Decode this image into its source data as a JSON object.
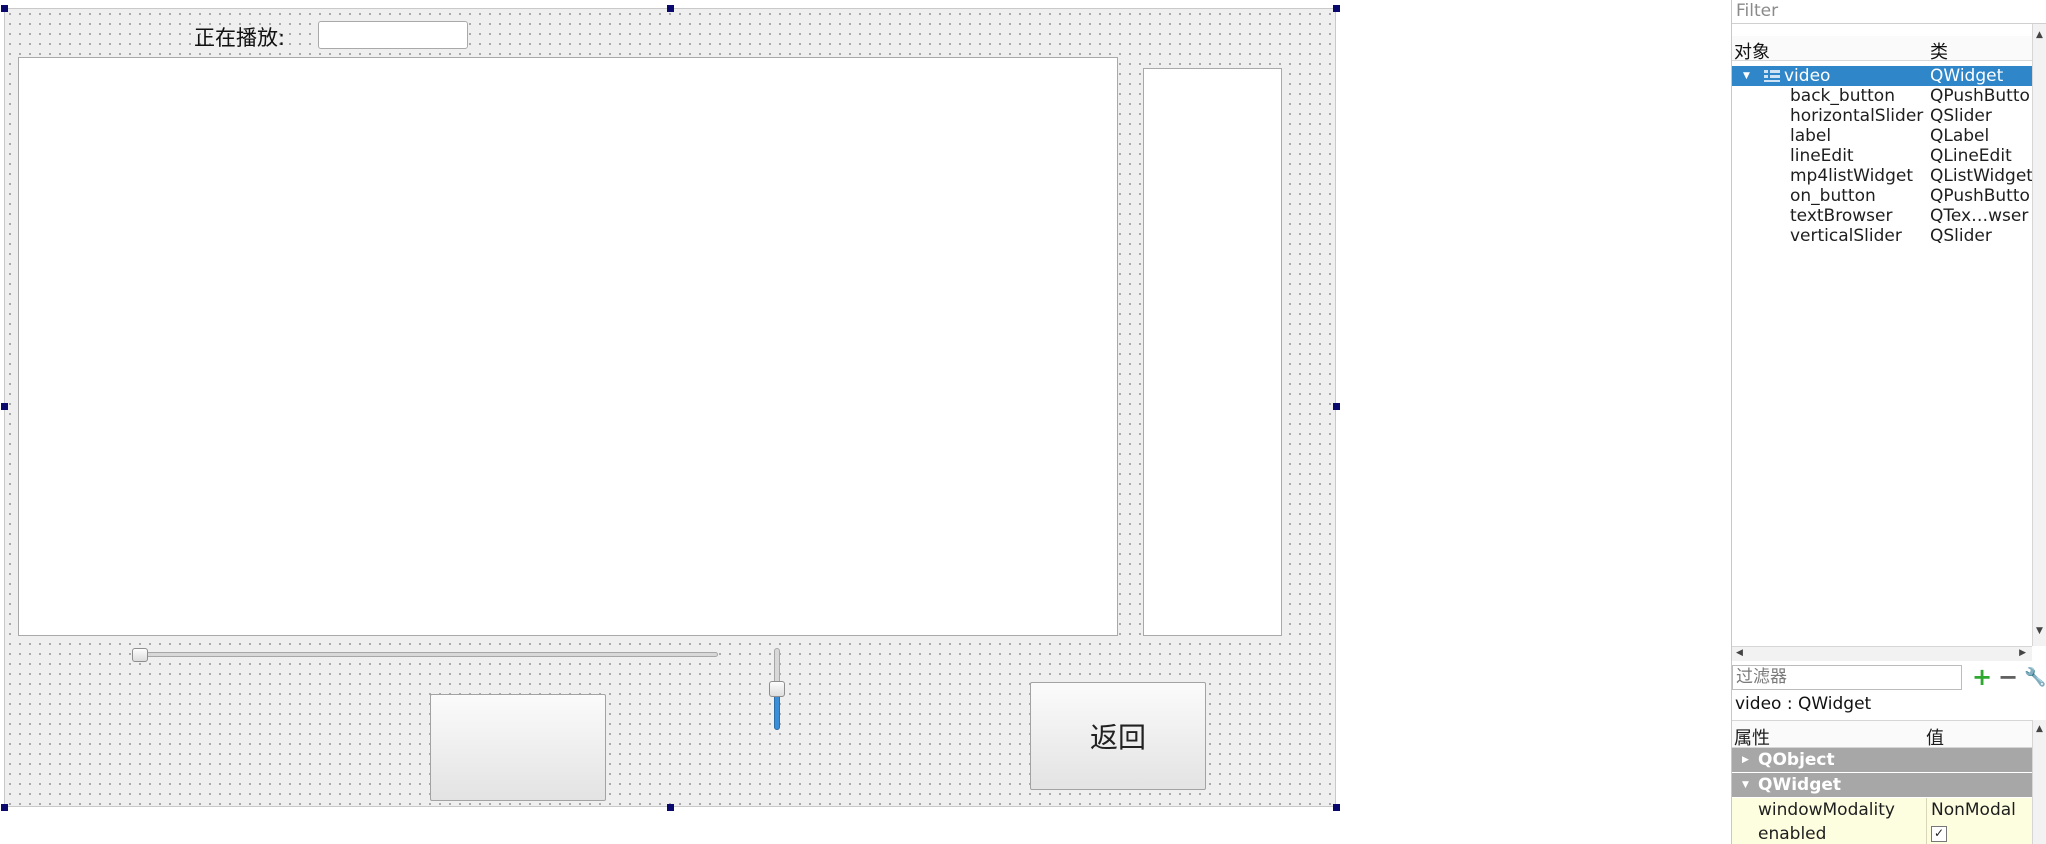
{
  "form": {
    "playing_label": "正在播放:",
    "line_edit_value": "",
    "on_button_label": "",
    "back_button_label": "返回",
    "horizontal_slider_value": 0.0,
    "vertical_slider_value": 0.4
  },
  "object_inspector": {
    "filter_placeholder": "Filter",
    "col_object": "对象",
    "col_class": "类",
    "rows": [
      {
        "name": "video",
        "class": "QWidget",
        "selected": true
      },
      {
        "name": "back_button",
        "class": "QPushButto"
      },
      {
        "name": "horizontalSlider",
        "class": "QSlider"
      },
      {
        "name": "label",
        "class": "QLabel"
      },
      {
        "name": "lineEdit",
        "class": "QLineEdit"
      },
      {
        "name": "mp4listWidget",
        "class": "QListWidget"
      },
      {
        "name": "on_button",
        "class": "QPushButto"
      },
      {
        "name": "textBrowser",
        "class": "QTex…wser"
      },
      {
        "name": "verticalSlider",
        "class": "QSlider"
      }
    ]
  },
  "property_editor": {
    "filter_placeholder": "过滤器",
    "object_class_line": "video : QWidget",
    "col_property": "属性",
    "col_value": "值",
    "groups": [
      "QObject",
      "QWidget"
    ],
    "props": [
      {
        "key": "windowModality",
        "value": "NonModal"
      },
      {
        "key": "enabled",
        "value": "✓"
      }
    ]
  },
  "colors": {
    "selection": "#2f86c9",
    "group_header": "#a7a7a7",
    "prop_row_bg": "#fdfde0",
    "handle": "#0a0a6e",
    "slider_fill": "#3a8fd8"
  }
}
